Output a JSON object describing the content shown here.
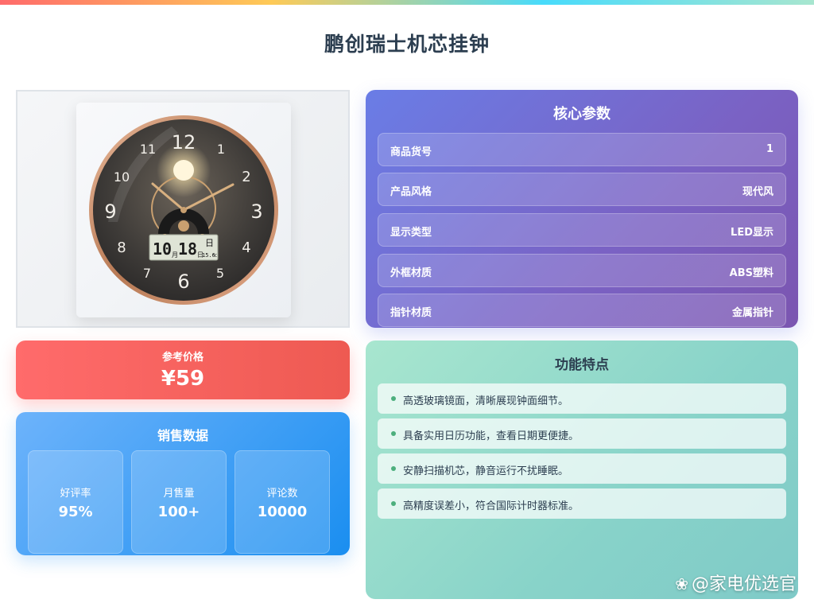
{
  "page": {
    "title": "鹏创瑞士机芯挂钟"
  },
  "image": {
    "clock_numbers": [
      "12",
      "1",
      "2",
      "3",
      "4",
      "5",
      "6",
      "7",
      "8",
      "9",
      "10",
      "11"
    ],
    "lcd": {
      "month": "10",
      "month_unit": "月",
      "day": "18",
      "day_unit": "日",
      "weekday": "日",
      "temp": "15.6",
      "temp_unit": "°C"
    }
  },
  "core": {
    "title": "核心参数",
    "params": [
      {
        "key": "商品货号",
        "value": "1"
      },
      {
        "key": "产品风格",
        "value": "现代风"
      },
      {
        "key": "显示类型",
        "value": "LED显示"
      },
      {
        "key": "外框材质",
        "value": "ABS塑料"
      },
      {
        "key": "指针材质",
        "value": "金属指针"
      }
    ]
  },
  "price": {
    "label": "参考价格",
    "value": "¥59"
  },
  "sales": {
    "title": "销售数据",
    "stats": [
      {
        "label": "好评率",
        "value": "95%"
      },
      {
        "label": "月售量",
        "value": "100+"
      },
      {
        "label": "评论数",
        "value": "10000"
      }
    ]
  },
  "features": {
    "title": "功能特点",
    "items": [
      "高透玻璃镜面，清晰展现钟面细节。",
      "具备实用日历功能，查看日期更便捷。",
      "安静扫描机芯，静音运行不扰睡眠。",
      "高精度误差小，符合国际计时器标准。"
    ]
  },
  "watermark": {
    "text": "@家电优选官",
    "icon": "paw-icon"
  },
  "colors": {
    "accent_bar": [
      "#ff6b6b",
      "#feca57",
      "#48dbfb",
      "#a8e6cf"
    ],
    "core_panel": "#6a7de6",
    "price_panel": "#ff6b6b",
    "sales_panel": "#1a8ef0",
    "feature_panel": "#a8e6cf",
    "title_text": "#2c3e50"
  }
}
